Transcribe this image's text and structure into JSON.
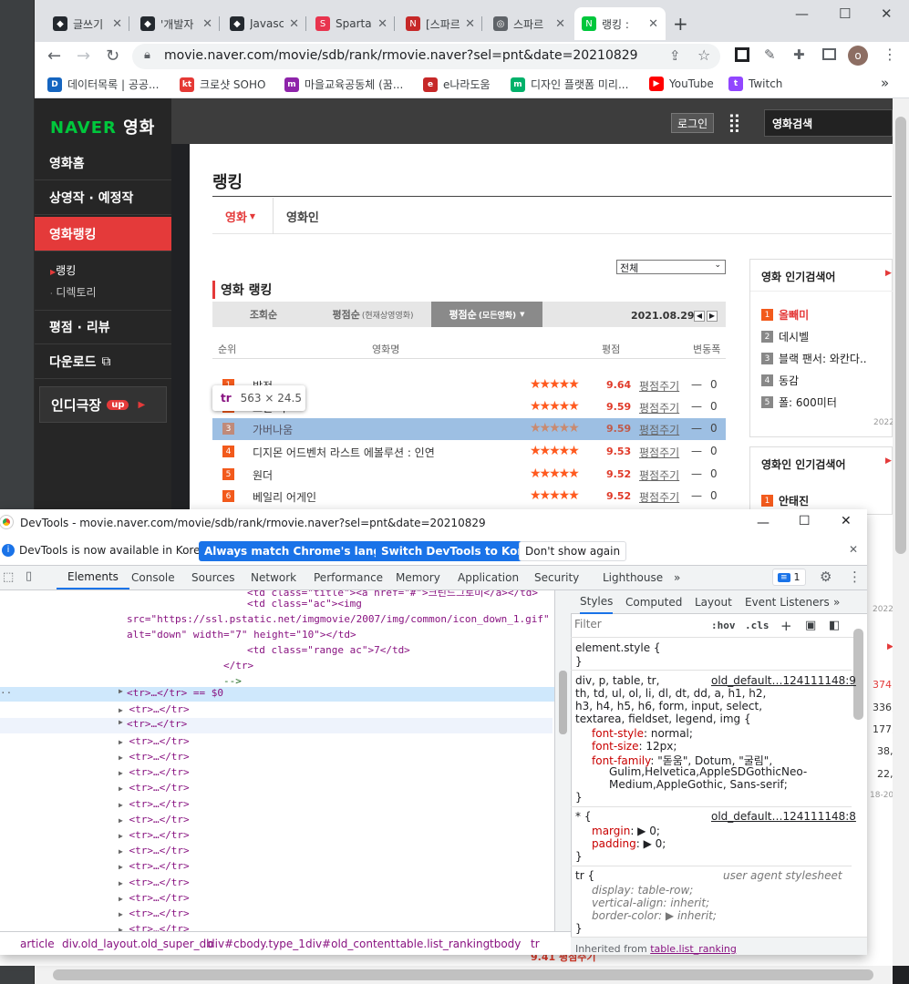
{
  "browser": {
    "tabs": [
      {
        "label": "글쓰기",
        "icon": "github-icon",
        "color": "#24292f"
      },
      {
        "label": "'개발자",
        "icon": "github-icon",
        "color": "#24292f"
      },
      {
        "label": "Javascr",
        "icon": "github-icon",
        "color": "#24292f"
      },
      {
        "label": "Sparta",
        "icon": "sparta-icon",
        "color": "#e8344e"
      },
      {
        "label": "[스파르",
        "icon": "notion-icon",
        "color": "#c62828"
      },
      {
        "label": "스파르",
        "icon": "globe-icon",
        "color": "#5f6368"
      },
      {
        "label": "랭킹 :",
        "icon": "naver-icon",
        "color": "#00c73c"
      }
    ],
    "url": "movie.naver.com/movie/sdb/rank/rmovie.naver?sel=pnt&date=20210829",
    "bookmarks": [
      {
        "label": "데이터목록 | 공공...",
        "icon": "D",
        "color": "#1565c0"
      },
      {
        "label": "크로샷 SOHO",
        "icon": "kt",
        "color": "#e53935"
      },
      {
        "label": "마을교육공동체 (꿈...",
        "icon": "m",
        "color": "#8e24aa"
      },
      {
        "label": "e나라도움",
        "icon": "e",
        "color": "#c62828"
      },
      {
        "label": "디자인 플랫폼 미리...",
        "icon": "m",
        "color": "#00b16a"
      },
      {
        "label": "YouTube",
        "icon": "▶",
        "color": "#ff0000"
      },
      {
        "label": "Twitch",
        "icon": "t",
        "color": "#9146ff"
      }
    ],
    "more_bookmarks": "»",
    "profile_letter": "o"
  },
  "naver": {
    "logo_brand": "NAVER",
    "logo_suffix": "영화",
    "login": "로그인",
    "search_placeholder": "영화검색",
    "nav": [
      "영화홈",
      "상영작 · 예정작",
      "영화랭킹",
      "평점 · 리뷰",
      "다운로드"
    ],
    "subnav": [
      "랭킹",
      "디렉토리"
    ],
    "indie": "인디극장",
    "indie_badge": "up",
    "page_title": "랭킹",
    "page_tabs": [
      "영화",
      "영화인"
    ],
    "section_title": "영화 랭킹",
    "select_value": "전체",
    "sort_tabs": [
      "조회순",
      "평점순",
      "(현재상영영화)",
      "평점순",
      "(모든영화)"
    ],
    "date": "2021.08.29",
    "col_headers": [
      "순위",
      "영화명",
      "평점",
      "변동폭"
    ],
    "rows": [
      {
        "rank": "1",
        "title": "밥정",
        "score": "9.64",
        "link": "평점주기",
        "change": "0"
      },
      {
        "rank": "2",
        "title": "그린 북",
        "score": "9.59",
        "link": "평점주기",
        "change": "0"
      },
      {
        "rank": "3",
        "title": "가버나움",
        "score": "9.59",
        "link": "평점주기",
        "change": "0"
      },
      {
        "rank": "4",
        "title": "디지몬 어드벤처 라스트 에볼루션 : 인연",
        "score": "9.53",
        "link": "평점주기",
        "change": "0"
      },
      {
        "rank": "5",
        "title": "원더",
        "score": "9.52",
        "link": "평점주기",
        "change": "0"
      },
      {
        "rank": "6",
        "title": "베일리 어게인",
        "score": "9.52",
        "link": "평점주기",
        "change": "0"
      }
    ],
    "change_dash": "—",
    "side_popular_movie": "영화 인기검색어",
    "side_movie_items": [
      "올빼미",
      "데시벨",
      "블랙 팬서: 와칸다..",
      "동감",
      "폴: 600미터"
    ],
    "side_movie_date": "2022",
    "side_popular_person": "영화인 인기검색어",
    "side_person_items": [
      "안태진"
    ],
    "side_overflow": [
      "2022",
      "374,",
      "336,",
      "177,",
      "38,",
      "22,",
      "18-202"
    ],
    "hidden_row_fragment": "9.41  평점주기"
  },
  "tooltip": {
    "tag": "tr",
    "size": "563 × 24.5"
  },
  "devtools": {
    "title": "DevTools - movie.naver.com/movie/sdb/rank/rmovie.naver?sel=pnt&date=20210829",
    "info_text": "DevTools is now available in Korean!",
    "btn_match": "Always match Chrome's language",
    "btn_switch": "Switch DevTools to Korean",
    "btn_dismiss": "Don't show again",
    "tabs": [
      "Elements",
      "Console",
      "Sources",
      "Network",
      "Performance",
      "Memory",
      "Application",
      "Security",
      "Lighthouse"
    ],
    "issues_count": "1",
    "side_tabs": [
      "Styles",
      "Computed",
      "Layout",
      "Event Listeners"
    ],
    "filter_placeholder": "Filter",
    "hov": ":hov",
    "cls": ".cls",
    "elements": {
      "line1": "<td class=\"title\"><a href=\"#\">크린드그로미</a></td>",
      "line2a": "<td class=\"ac\"><img",
      "line2b": "src=\"https://ssl.pstatic.net/imgmovie/2007/img/common/icon_down_1.gif\"",
      "line2c": "alt=\"down\" width=\"7\" height=\"10\"></td>",
      "line3": "<td class=\"range ac\">7</td>",
      "line4": "</tr>",
      "line5": "-->",
      "selected": "<tr>…</tr> == $0",
      "collapsed": "<tr>…</tr>"
    },
    "breadcrumbs": [
      "article",
      "div.old_layout.old_super_db",
      "div#cbody.type_1",
      "div#old_content",
      "table.list_ranking",
      "tbody",
      "tr"
    ],
    "styles": {
      "element_style": "element.style {",
      "close": "}",
      "rule1_selector": "div, p, table, tr,",
      "rule1_selector2": "th, td, ul, ol, li, dl, dt, dd, a, h1, h2,",
      "rule1_selector3": "h3, h4, h5, h6, form, input, select,",
      "rule1_selector4": "textarea, fieldset, legend, img {",
      "rule1_source": "old_default…124111148:9",
      "p1": "font-style",
      "v1": "normal;",
      "p2": "font-size",
      "v2": "12px;",
      "p3": "font-family",
      "v3": "\"돋움\", Dotum, \"굴림\",",
      "v3b": "Gulim,Helvetica,AppleSDGothicNeo-",
      "v3c": "Medium,AppleGothic, Sans-serif;",
      "rule2_selector": "* {",
      "rule2_source": "old_default…124111148:8",
      "p4": "margin",
      "v4": "0;",
      "p5": "padding",
      "v5": "0;",
      "rule3_selector": "tr {",
      "rule3_source": "user agent stylesheet",
      "p6": "display",
      "v6": "table-row;",
      "p7": "vertical-align",
      "v7": "inherit;",
      "p8": "border-color",
      "v8": "inherit;",
      "inherited": "Inherited from",
      "inherited_from": "table.list_ranking"
    }
  }
}
